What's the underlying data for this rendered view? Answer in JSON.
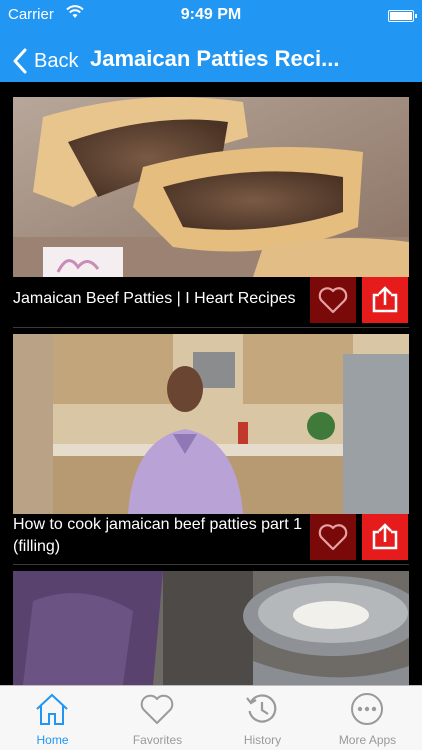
{
  "status": {
    "carrier": "Carrier",
    "time": "9:49 PM"
  },
  "nav": {
    "back_label": "Back",
    "title": "Jamaican Patties Reci..."
  },
  "videos": [
    {
      "caption": "Jamaican Beef Patties | I Heart Recipes"
    },
    {
      "caption": "How to cook jamaican beef patties part 1 (filling)"
    }
  ],
  "tabs": [
    {
      "label": "Home",
      "icon": "home-icon",
      "active": true
    },
    {
      "label": "Favorites",
      "icon": "heart-icon",
      "active": false
    },
    {
      "label": "History",
      "icon": "history-icon",
      "active": false
    },
    {
      "label": "More Apps",
      "icon": "more-icon",
      "active": false
    }
  ],
  "colors": {
    "accent": "#2196f3",
    "favorite_button": "#7a0a0a",
    "share_button": "#e61c1c",
    "tab_inactive": "#9a9a9a"
  }
}
